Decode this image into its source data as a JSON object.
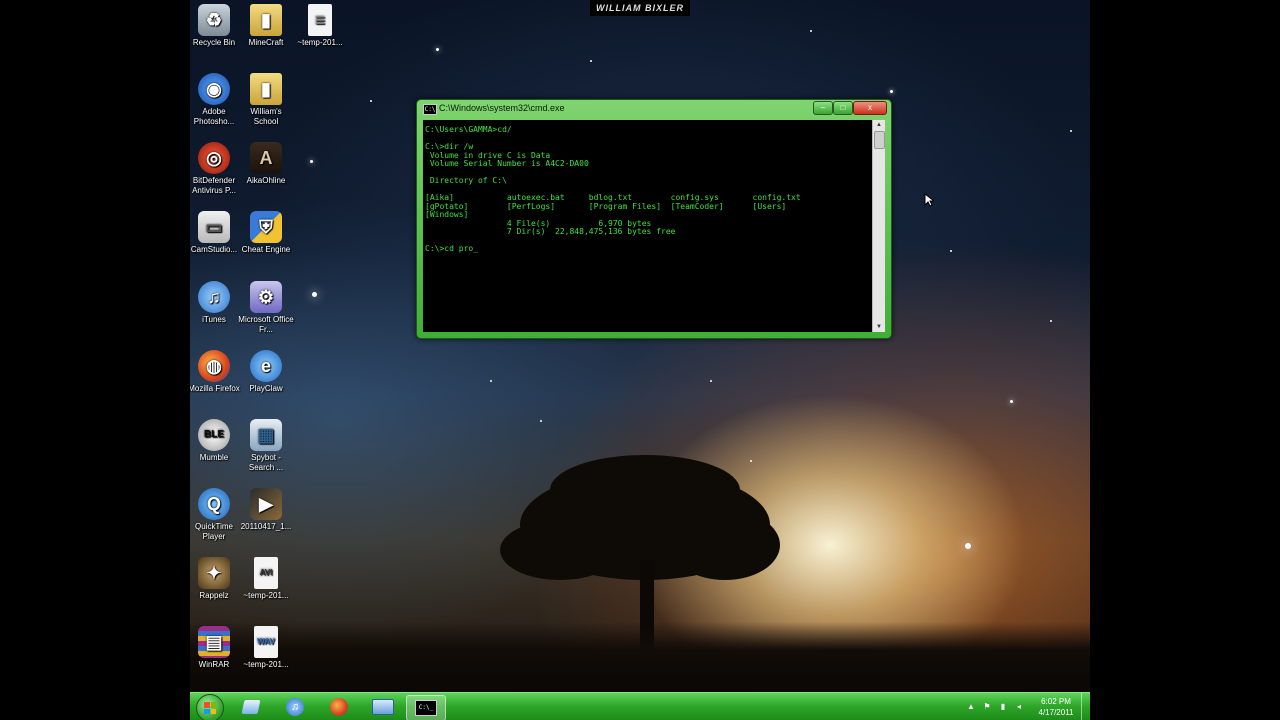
{
  "watermark": "WILLIAM BIXLER",
  "desktop_icons": [
    {
      "label": "Recycle Bin",
      "icon": "recycle-bin-icon"
    },
    {
      "label": "MineCraft",
      "icon": "folder-icon"
    },
    {
      "label": "~temp-201...",
      "icon": "document-icon"
    },
    {
      "label": "Adobe Photosho...",
      "icon": "camera-icon"
    },
    {
      "label": "William's School",
      "icon": "folder-icon"
    },
    {
      "label": "BitDefender Antivirus P...",
      "icon": "bitdefender-icon"
    },
    {
      "label": "AikaOhline",
      "icon": "aika-icon"
    },
    {
      "label": "CamStudio...",
      "icon": "window-icon"
    },
    {
      "label": "Cheat Engine",
      "icon": "shield-icon"
    },
    {
      "label": "iTunes",
      "icon": "music-note-icon"
    },
    {
      "label": "Microsoft Office Fr...",
      "icon": "office-icon"
    },
    {
      "label": "Mozilla Firefox",
      "icon": "firefox-icon"
    },
    {
      "label": "PlayClaw",
      "icon": "playclaw-icon"
    },
    {
      "label": "Mumble",
      "icon": "mumble-icon"
    },
    {
      "label": "Spybot - Search ...",
      "icon": "spybot-icon"
    },
    {
      "label": "QuickTime Player",
      "icon": "quicktime-icon"
    },
    {
      "label": "20110417_1...",
      "icon": "video-icon"
    },
    {
      "label": "Rappelz",
      "icon": "rappelz-icon"
    },
    {
      "label": "~temp-201...",
      "icon": "avi-file-icon"
    },
    {
      "label": "WinRAR",
      "icon": "winrar-icon"
    },
    {
      "label": "~temp-201...",
      "icon": "wav-file-icon"
    }
  ],
  "cmd": {
    "title": "C:\\Windows\\system32\\cmd.exe",
    "lines": [
      "C:\\Users\\GAMMA>cd/",
      "",
      "C:\\>dir /w",
      " Volume in drive C is Data",
      " Volume Serial Number is A4C2-DA00",
      "",
      " Directory of C:\\",
      "",
      "[Aika]           autoexec.bat     bdlog.txt        config.sys       config.txt",
      "[gPotato]        [PerfLogs]       [Program Files]  [TeamCoder]      [Users]",
      "[Windows]",
      "                 4 File(s)          6,970 bytes",
      "                 7 Dir(s)  22,848,475,136 bytes free",
      "",
      "C:\\>cd pro_"
    ],
    "buttons": {
      "minimize": "–",
      "maximize": "□",
      "close": "x"
    }
  },
  "taskbar": {
    "items": [
      {
        "name": "explorer",
        "icon": "folder-icon",
        "active": false
      },
      {
        "name": "itunes",
        "icon": "music-note-icon",
        "active": false
      },
      {
        "name": "firefox",
        "icon": "firefox-icon",
        "active": false
      },
      {
        "name": "remote",
        "icon": "monitor-icon",
        "active": false
      },
      {
        "name": "cmd",
        "icon": "cmd-icon",
        "active": true
      }
    ],
    "clock_time": "6:02 PM",
    "clock_date": "4/17/2011"
  },
  "colors": {
    "console_text": "#3fe23f",
    "taskbar_green": "#2fa82a",
    "window_frame": "#5cc74f"
  }
}
